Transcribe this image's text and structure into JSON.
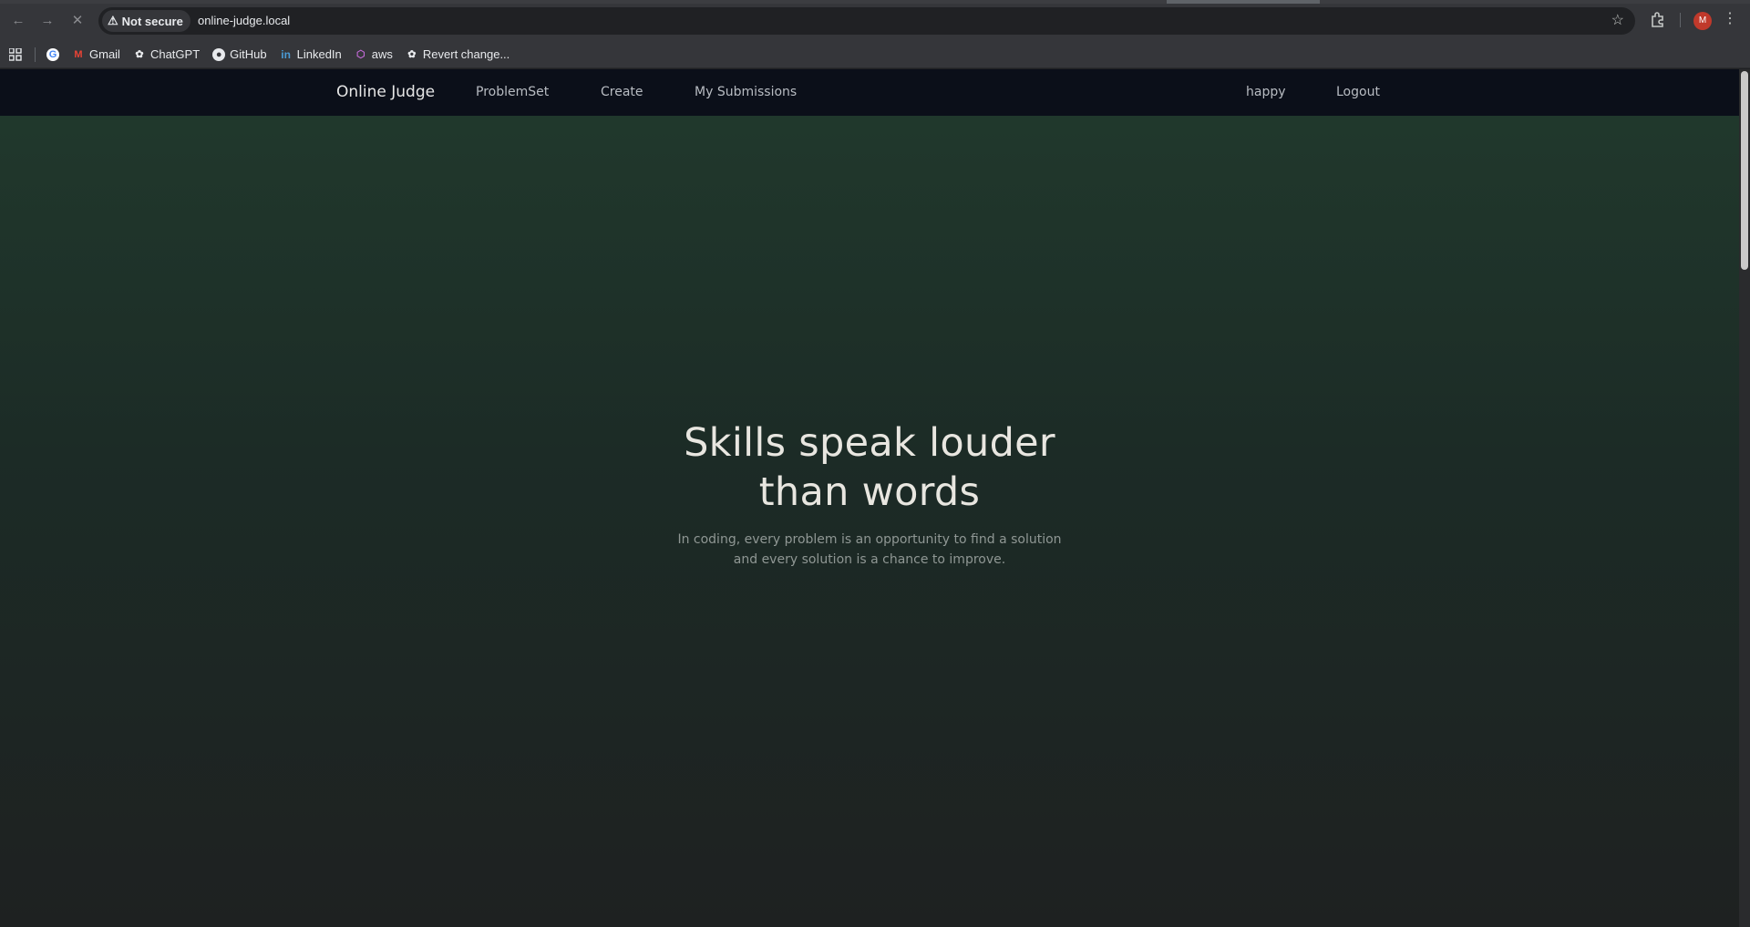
{
  "browser": {
    "security_label": "Not secure",
    "url": "online-judge.local",
    "profile_initial": "M",
    "bookmarks": [
      {
        "label": "Gmail"
      },
      {
        "label": "ChatGPT"
      },
      {
        "label": "GitHub"
      },
      {
        "label": "LinkedIn"
      },
      {
        "label": "aws"
      },
      {
        "label": "Revert change..."
      }
    ]
  },
  "navbar": {
    "brand": "Online Judge",
    "links": [
      "ProblemSet",
      "Create",
      "My Submissions"
    ],
    "user": "happy",
    "logout": "Logout"
  },
  "hero": {
    "title_line1": "Skills speak louder",
    "title_line2": "than words",
    "subtitle_line1": "In coding, every problem is an opportunity to find a solution",
    "subtitle_line2": "and every solution is a chance to improve."
  },
  "colors": {
    "navbar_bg": "#0b0f19",
    "hero_gradient_top": "#213a2d",
    "hero_gradient_bottom": "#1e2121"
  }
}
